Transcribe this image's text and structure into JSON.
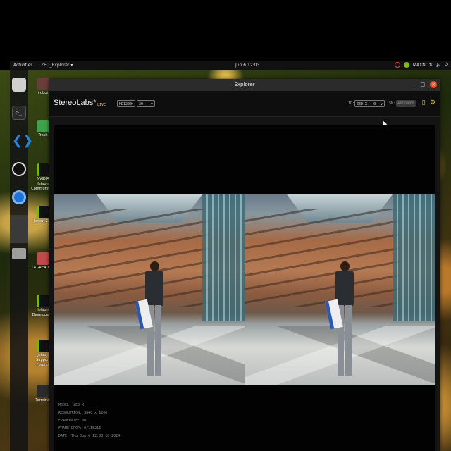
{
  "topbar": {
    "activities": "Activities",
    "app_menu": "ZED_Explorer ▾",
    "clock": "Jun 6 12:03",
    "power_mode": "MAXN"
  },
  "desktop_icons": [
    {
      "label": "irobot"
    },
    {
      "label": "Trash"
    },
    {
      "label": "NVIDIA Jetson Community P"
    },
    {
      "label": "Jetson Zoo"
    },
    {
      "label": "L4T-README"
    },
    {
      "label": "Jetson Developer Z"
    },
    {
      "label": "Jetson Support Forums"
    },
    {
      "label": "Terminal"
    }
  ],
  "window": {
    "title": "Explorer",
    "brand": "StereoLabs*",
    "live_label": "LIVE",
    "resolution": "HD1200",
    "fps": "30",
    "id_label": "ID:",
    "id_value": "ZED X - 0",
    "sn_label": "SN:",
    "sn_value": "44520808"
  },
  "camera_info": {
    "model": "MODEL: ZED X",
    "resolution": "RESOLUTION: 3840 x 1200",
    "framerate": "FRAMERATE: 30",
    "frame_drop": "FRAME DROP: 0/118216",
    "date": "DATE: Thu Jun 6 12:03:18 2024"
  },
  "colors": {
    "accent_orange": "#e95420",
    "brand_yellow": "#d4c24a",
    "nvidia_green": "#76b900"
  }
}
